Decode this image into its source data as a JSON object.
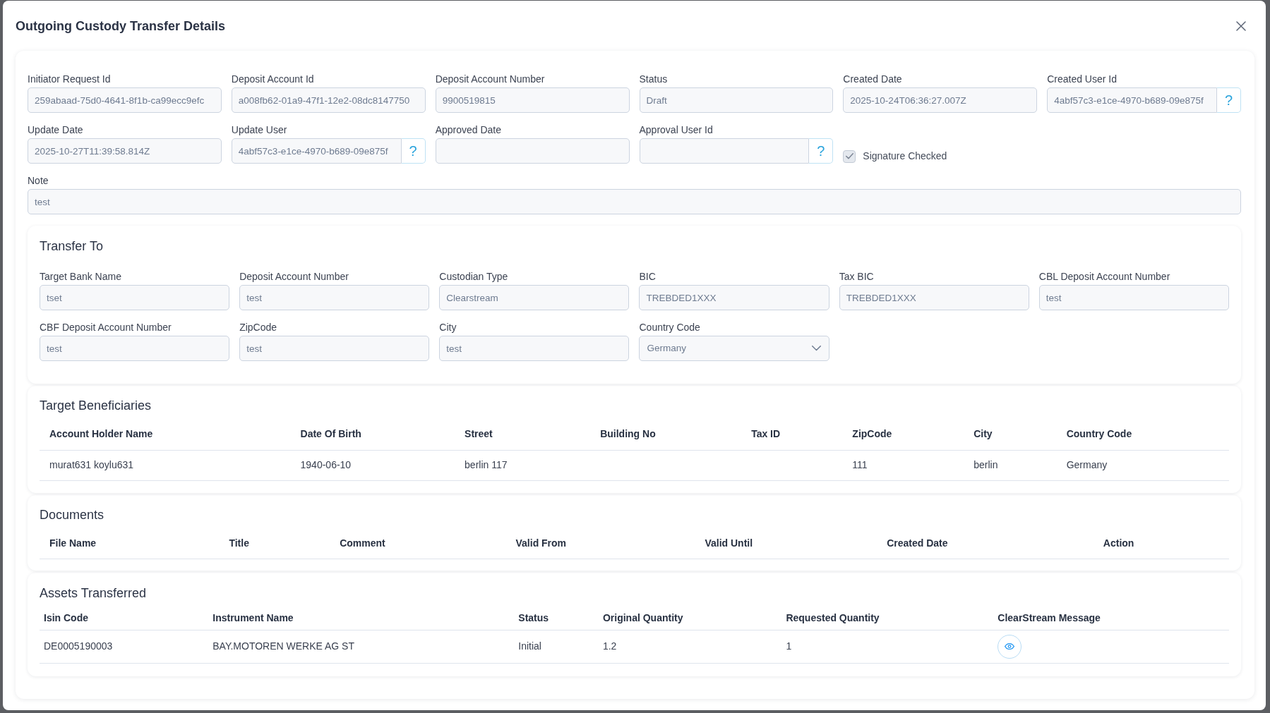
{
  "dialog": {
    "title": "Outgoing Custody Transfer Details"
  },
  "fields": [
    {
      "kind": "text",
      "label": "Initiator Request Id",
      "value": "259abaad-75d0-4641-8f1b-ca99ecc9efc"
    },
    {
      "kind": "text",
      "label": "Deposit Account Id",
      "value": "a008fb62-01a9-47f1-12e2-08dc8147750"
    },
    {
      "kind": "text",
      "label": "Deposit Account Number",
      "value": "9900519815"
    },
    {
      "kind": "text",
      "label": "Status",
      "value": "Draft"
    },
    {
      "kind": "text",
      "label": "Created Date",
      "value": "2025-10-24T06:36:27.007Z"
    },
    {
      "kind": "lookup",
      "label": "Created User Id",
      "value": "4abf57c3-e1ce-4970-b689-09e875f",
      "button": "?"
    },
    {
      "kind": "text",
      "label": "Update Date",
      "value": "2025-10-27T11:39:58.814Z"
    },
    {
      "kind": "lookup",
      "label": "Update User",
      "value": "4abf57c3-e1ce-4970-b689-09e875f",
      "button": "?"
    },
    {
      "kind": "text",
      "label": "Approved Date"
    },
    {
      "kind": "lookup",
      "label": "Approval User Id",
      "button": "?"
    },
    {
      "kind": "checkbox",
      "label": "Signature Checked",
      "checked": true,
      "disabled": true
    },
    {
      "kind": "wide",
      "label": "Note",
      "value": "test"
    }
  ],
  "transfer_to": {
    "title": "Transfer To",
    "fields": [
      {
        "kind": "text",
        "label": "Target Bank Name",
        "value": "tset"
      },
      {
        "kind": "text",
        "label": "Deposit Account Number",
        "value": "test"
      },
      {
        "kind": "text",
        "label": "Custodian Type",
        "value": "Clearstream"
      },
      {
        "kind": "text",
        "label": "BIC",
        "value": "TREBDED1XXX"
      },
      {
        "kind": "text",
        "label": "Tax BIC",
        "value": "TREBDED1XXX"
      },
      {
        "kind": "text",
        "label": "CBL Deposit Account Number",
        "value": "test"
      },
      {
        "kind": "text",
        "label": "CBF Deposit Account Number",
        "value": "test"
      },
      {
        "kind": "text",
        "label": "ZipCode",
        "value": "test"
      },
      {
        "kind": "text",
        "label": "City",
        "value": "test"
      },
      {
        "kind": "select",
        "label": "Country Code",
        "value": "Germany"
      }
    ]
  },
  "target_beneficiaries": {
    "title": "Target Beneficiaries",
    "columns": [
      "Account Holder Name",
      "Date Of Birth",
      "Street",
      "Building No",
      "Tax ID",
      "ZipCode",
      "City",
      "Country Code"
    ],
    "rows": [
      [
        "murat631 koylu631",
        "1940-06-10",
        "berlin 117",
        null,
        null,
        "111",
        "berlin",
        "Germany"
      ]
    ]
  },
  "documents": {
    "title": "Documents",
    "columns": [
      "File Name",
      "Title",
      "Comment",
      "Valid From",
      "Valid Until",
      "Created Date",
      "Action"
    ]
  },
  "assets_transferred": {
    "title": "Assets Transferred",
    "columns": [
      "Isin Code",
      "Instrument Name",
      "Status",
      "Original Quantity",
      "Requested Quantity",
      "ClearStream Message"
    ],
    "rows": [
      {
        "cells": [
          "DE0005190003",
          "BAY.MOTOREN WERKE AG ST",
          "Initial",
          "1.2",
          "1"
        ],
        "has_message": true
      }
    ]
  }
}
